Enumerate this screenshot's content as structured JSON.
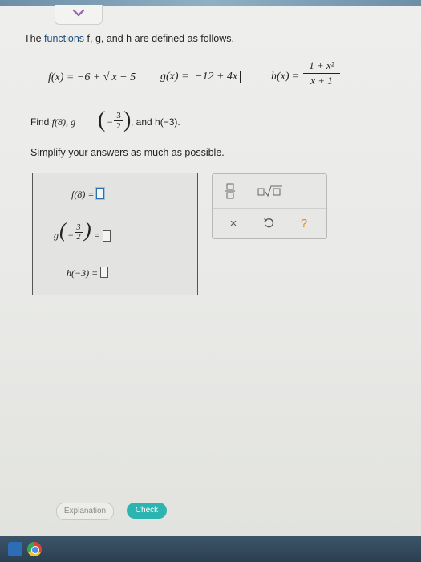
{
  "intro": {
    "before": "The ",
    "link": "functions",
    "middle": " f, g, and h are defined as follows."
  },
  "definitions": {
    "f": {
      "lhs": "f(x) = −6 + ",
      "radicand": "x − 5"
    },
    "g": {
      "lhs": "g(x) = ",
      "abs_inner": "−12 + 4x"
    },
    "h": {
      "lhs": "h(x) = ",
      "numerator": "1 + x²",
      "denominator": "x + 1"
    }
  },
  "find": {
    "prefix": "Find ",
    "f_term": "f(8), g",
    "frac_num": "3",
    "frac_den": "2",
    "neg": "−",
    "suffix": ", and h(−3)."
  },
  "instruction": "Simplify your answers as much as possible.",
  "answers": {
    "f_label": "f(8) =",
    "g_label_prefix": "g",
    "g_neg": "−",
    "g_num": "3",
    "g_den": "2",
    "g_eq": "=",
    "h_label": "h(−3) ="
  },
  "palette": {
    "fraction_icon": "fraction-icon",
    "sqrt_icon": "square-root-icon",
    "clear_label": "×",
    "undo_icon": "undo-icon",
    "help_label": "?"
  },
  "footer": {
    "explanation_label": "Explanation",
    "check_label": "Check"
  },
  "colors": {
    "check": "#2bb4b0",
    "help": "#d98a1c",
    "link": "#1f4f7a"
  }
}
